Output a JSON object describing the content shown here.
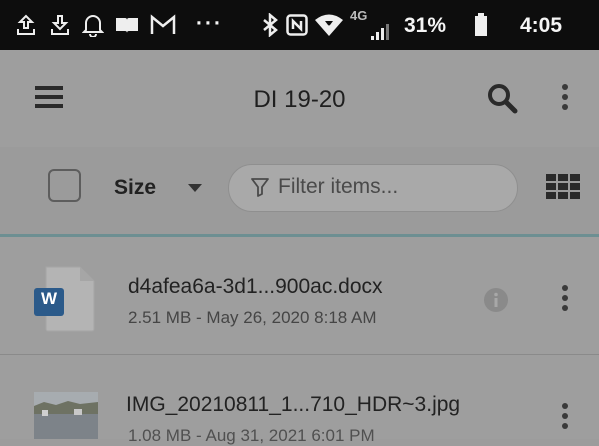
{
  "status_bar": {
    "icons": [
      "upload-icon",
      "download-icon",
      "bell-icon",
      "reader-icon",
      "gmail-icon",
      "overflow-dots-icon",
      "bluetooth-icon",
      "nfc-icon",
      "wifi-icon",
      "4g-lte-signal-icon",
      "battery-icon"
    ],
    "dots": "···",
    "network": "4G",
    "battery": "31%",
    "time": "4:05"
  },
  "toolbar": {
    "title": "DI 19-20",
    "icons": [
      "menu-icon",
      "search-icon",
      "more-vert-icon"
    ]
  },
  "filter_bar": {
    "sort_label": "Size",
    "filter_placeholder": "Filter items...",
    "icons": [
      "checkbox-icon",
      "dropdown-caret-icon",
      "filter-icon",
      "grid-view-icon"
    ]
  },
  "files": [
    {
      "name": "d4afea6a-3d1...900ac.docx",
      "meta": "2.51 MB - May 26, 2020 8:18 AM",
      "icon": "word-doc-icon",
      "badge": "W",
      "has_info": true
    },
    {
      "name": "IMG_20210811_1...710_HDR~3.jpg",
      "meta": "1.08 MB - Aug 31, 2021 6:01 PM",
      "icon": "image-thumbnail-icon",
      "has_info": false
    }
  ],
  "colors": {
    "status_bar": "#0d0d0d",
    "scrim_background": "#9e9e9e",
    "accent_line": "#6d8f92",
    "word_blue": "#2b5a8a"
  }
}
